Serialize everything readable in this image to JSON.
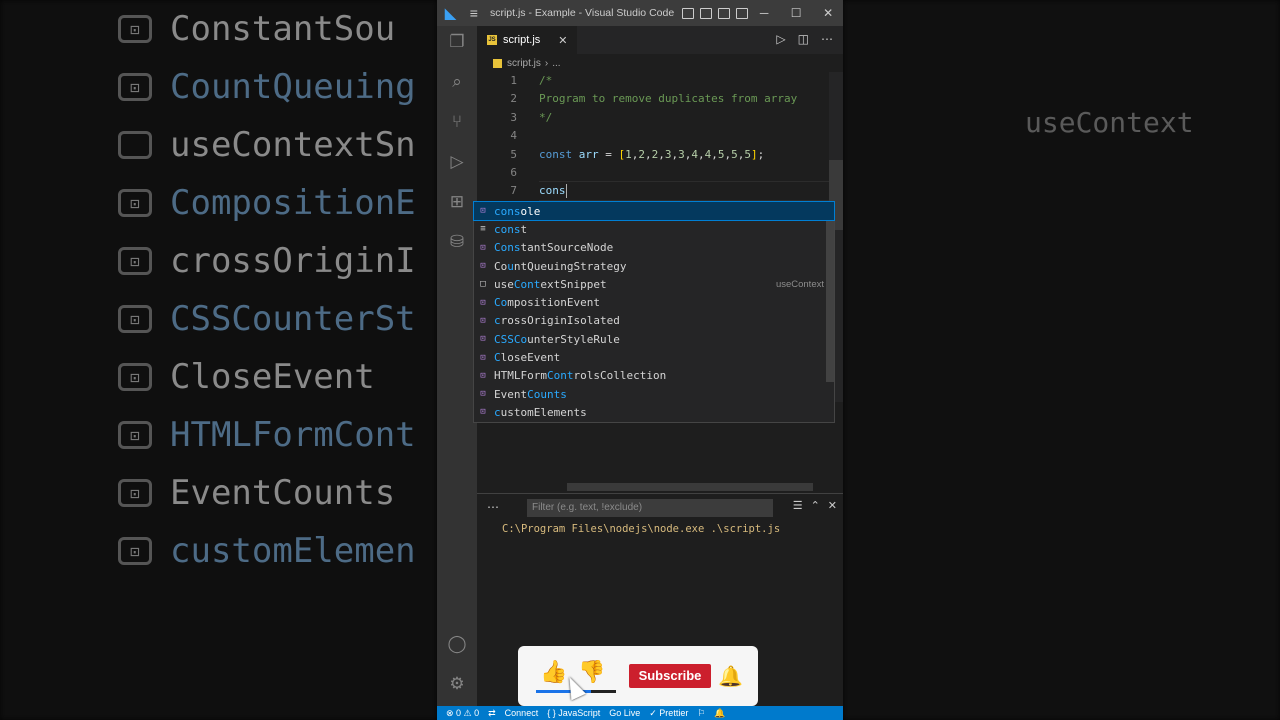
{
  "background": {
    "suggestions": [
      {
        "icon": "⊡",
        "text": "ConstantSou"
      },
      {
        "icon": "⊡",
        "text": "CountQueuing"
      },
      {
        "icon": "",
        "text": "useContextSn"
      },
      {
        "icon": "⊡",
        "text": "CompositionE"
      },
      {
        "icon": "⊡",
        "text": "crossOriginI"
      },
      {
        "icon": "⊡",
        "text": "CSSCounterSt"
      },
      {
        "icon": "⊡",
        "text": "CloseEvent"
      },
      {
        "icon": "⊡",
        "text": "HTMLFormCont"
      },
      {
        "icon": "⊡",
        "text": "EventCounts"
      },
      {
        "icon": "⊡",
        "text": "customElemen"
      }
    ],
    "context_text": "useContext"
  },
  "window": {
    "title": "script.js - Example - Visual Studio Code",
    "menu_icon": "≡"
  },
  "tab": {
    "label": "script.js",
    "close": "✕"
  },
  "breadcrumb": {
    "file": "script.js",
    "sep": "›",
    "more": "..."
  },
  "editor": {
    "lines": [
      {
        "n": "1",
        "tokens": [
          {
            "c": "c-com",
            "t": "/*"
          }
        ]
      },
      {
        "n": "2",
        "tokens": [
          {
            "c": "c-com",
            "t": "Program to remove duplicates from array"
          }
        ]
      },
      {
        "n": "3",
        "tokens": [
          {
            "c": "c-com",
            "t": "*/"
          }
        ]
      },
      {
        "n": "4",
        "tokens": []
      },
      {
        "n": "5",
        "tokens": [
          {
            "c": "c-kw",
            "t": "const "
          },
          {
            "c": "c-var",
            "t": "arr"
          },
          {
            "c": "c-pun",
            "t": " = "
          },
          {
            "c": "c-br",
            "t": "["
          },
          {
            "c": "c-num",
            "t": "1"
          },
          {
            "c": "c-pun",
            "t": ","
          },
          {
            "c": "c-num",
            "t": "2"
          },
          {
            "c": "c-pun",
            "t": ","
          },
          {
            "c": "c-num",
            "t": "2"
          },
          {
            "c": "c-pun",
            "t": ","
          },
          {
            "c": "c-num",
            "t": "3"
          },
          {
            "c": "c-pun",
            "t": ","
          },
          {
            "c": "c-num",
            "t": "3"
          },
          {
            "c": "c-pun",
            "t": ","
          },
          {
            "c": "c-num",
            "t": "4"
          },
          {
            "c": "c-pun",
            "t": ","
          },
          {
            "c": "c-num",
            "t": "4"
          },
          {
            "c": "c-pun",
            "t": ","
          },
          {
            "c": "c-num",
            "t": "5"
          },
          {
            "c": "c-pun",
            "t": ","
          },
          {
            "c": "c-num",
            "t": "5"
          },
          {
            "c": "c-pun",
            "t": ","
          },
          {
            "c": "c-num",
            "t": "5"
          },
          {
            "c": "c-br",
            "t": "]"
          },
          {
            "c": "c-pun",
            "t": ";"
          }
        ]
      },
      {
        "n": "6",
        "tokens": []
      },
      {
        "n": "7",
        "tokens": [
          {
            "c": "c-var",
            "t": "cons"
          }
        ]
      }
    ]
  },
  "suggest": {
    "items": [
      {
        "kind": "var",
        "pre": "",
        "match": "cons",
        "post": "ole",
        "detail": "",
        "selected": true
      },
      {
        "kind": "kw",
        "pre": "",
        "match": "cons",
        "post": "t",
        "detail": "",
        "selected": false
      },
      {
        "kind": "var",
        "pre": "",
        "match": "Cons",
        "post": "tantSourceNode",
        "detail": "",
        "selected": false
      },
      {
        "kind": "var",
        "pre": "Co",
        "match": "u",
        "post": "ntQueuingStrategy",
        "detail": "",
        "selected": false
      },
      {
        "kind": "snip",
        "pre": "use",
        "match": "Cont",
        "post": "extSnippet",
        "detail": "useContext",
        "selected": false
      },
      {
        "kind": "var",
        "pre": "",
        "match": "Co",
        "post": "mpositionEvent",
        "detail": "",
        "selected": false
      },
      {
        "kind": "var",
        "pre": "",
        "match": "c",
        "post": "rossOriginIsolated",
        "detail": "",
        "selected": false
      },
      {
        "kind": "var",
        "pre": "",
        "match": "CSSCo",
        "post": "unterStyleRule",
        "detail": "",
        "selected": false
      },
      {
        "kind": "var",
        "pre": "",
        "match": "C",
        "post": "loseEvent",
        "detail": "",
        "selected": false
      },
      {
        "kind": "var",
        "pre": "HTMLForm",
        "match": "Cont",
        "post": "rolsCollection",
        "detail": "",
        "selected": false
      },
      {
        "kind": "var",
        "pre": "Event",
        "match": "Counts",
        "post": "",
        "detail": "",
        "selected": false
      },
      {
        "kind": "var",
        "pre": "",
        "match": "c",
        "post": "ustomElements",
        "detail": "",
        "selected": false
      }
    ]
  },
  "panel": {
    "filter_placeholder": "Filter (e.g. text, !exclude)",
    "output": "C:\\Program Files\\nodejs\\node.exe .\\script.js"
  },
  "status": {
    "errors": "⊗ 0 ⚠ 0",
    "connect": "Connect",
    "language": "{ } JavaScript",
    "golive": "Go Live",
    "prettier": "✓ Prettier"
  },
  "overlay": {
    "subscribe_label": "Subscribe",
    "like_level": 0.69
  }
}
